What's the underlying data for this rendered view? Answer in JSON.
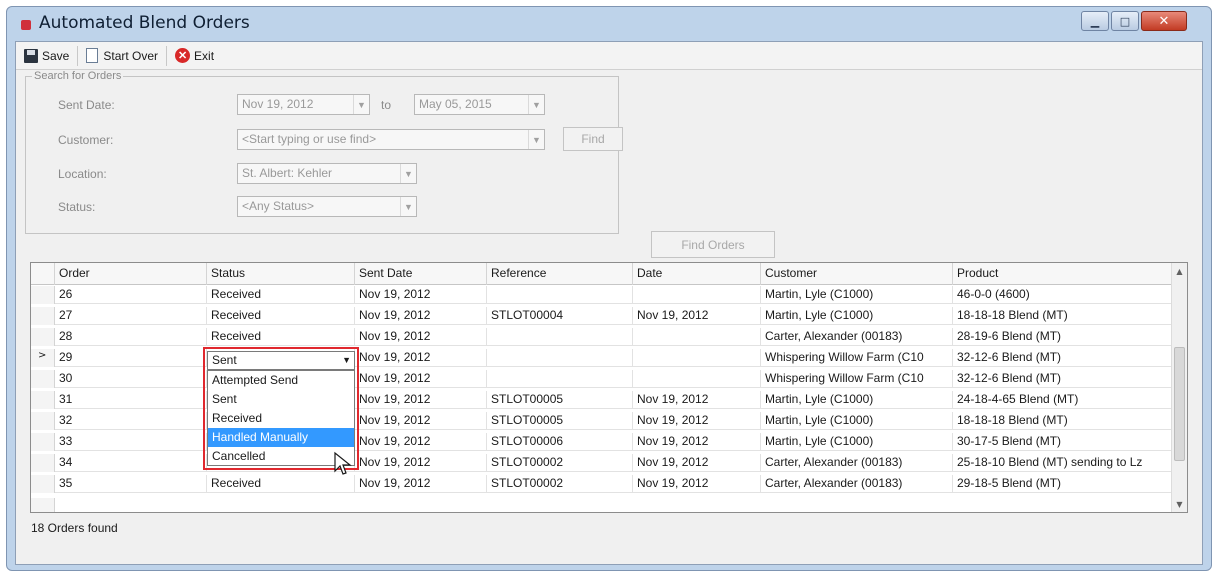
{
  "window": {
    "title": "Automated Blend Orders",
    "controls": [
      "minimize",
      "maximize",
      "close"
    ]
  },
  "toolbar": {
    "save_label": "Save",
    "start_over_label": "Start Over",
    "exit_label": "Exit"
  },
  "search": {
    "legend": "Search for Orders",
    "sent_date_label": "Sent Date:",
    "from_date": "Nov 19, 2012",
    "to_label": "to",
    "to_date": "May 05, 2015",
    "customer_label": "Customer:",
    "customer_placeholder": "<Start typing or use find>",
    "find_button": "Find",
    "location_label": "Location:",
    "location_value": "St. Albert: Kehler",
    "status_label": "Status:",
    "status_value": "<Any Status>",
    "find_orders_button": "Find Orders"
  },
  "grid": {
    "columns": [
      "Order",
      "Status",
      "Sent Date",
      "Reference",
      "Date",
      "Customer",
      "Product"
    ],
    "rows": [
      {
        "order": "26",
        "status": "Received",
        "sent_date": "Nov 19, 2012",
        "reference": "",
        "date": "",
        "customer": "Martin, Lyle (C1000)",
        "product": "46-0-0 (4600)"
      },
      {
        "order": "27",
        "status": "Received",
        "sent_date": "Nov 19, 2012",
        "reference": "STLOT00004",
        "date": "Nov 19, 2012",
        "customer": "Martin, Lyle (C1000)",
        "product": "18-18-18 Blend (MT)"
      },
      {
        "order": "28",
        "status": "Received",
        "sent_date": "Nov 19, 2012",
        "reference": "",
        "date": "",
        "customer": "Carter, Alexander (00183)",
        "product": "28-19-6 Blend (MT)"
      },
      {
        "order": "29",
        "status": "Sent",
        "sent_date": "Nov 19, 2012",
        "reference": "",
        "date": "",
        "customer": "Whispering Willow Farm (C10",
        "product": "32-12-6 Blend (MT)"
      },
      {
        "order": "30",
        "status": "",
        "sent_date": "Nov 19, 2012",
        "reference": "",
        "date": "",
        "customer": "Whispering Willow Farm (C10",
        "product": "32-12-6 Blend (MT)"
      },
      {
        "order": "31",
        "status": "",
        "sent_date": "Nov 19, 2012",
        "reference": "STLOT00005",
        "date": "Nov 19, 2012",
        "customer": "Martin, Lyle (C1000)",
        "product": "24-18-4-65 Blend (MT)"
      },
      {
        "order": "32",
        "status": "",
        "sent_date": "Nov 19, 2012",
        "reference": "STLOT00005",
        "date": "Nov 19, 2012",
        "customer": "Martin, Lyle (C1000)",
        "product": "18-18-18 Blend (MT)"
      },
      {
        "order": "33",
        "status": "",
        "sent_date": "Nov 19, 2012",
        "reference": "STLOT00006",
        "date": "Nov 19, 2012",
        "customer": "Martin, Lyle (C1000)",
        "product": "30-17-5 Blend (MT)"
      },
      {
        "order": "34",
        "status": "",
        "sent_date": "Nov 19, 2012",
        "reference": "STLOT00002",
        "date": "Nov 19, 2012",
        "customer": "Carter, Alexander (00183)",
        "product": "25-18-10 Blend (MT) sending to Lz"
      },
      {
        "order": "35",
        "status": "Received",
        "sent_date": "Nov 19, 2012",
        "reference": "STLOT00002",
        "date": "Nov 19, 2012",
        "customer": "Carter, Alexander (00183)",
        "product": "29-18-5 Blend (MT)"
      }
    ],
    "current_row_marker": ">",
    "editing_value": "Sent",
    "dropdown_options": [
      "Attempted Send",
      "Sent",
      "Received",
      "Handled Manually",
      "Cancelled"
    ],
    "highlighted_option": "Handled Manually"
  },
  "status_text": "18 Orders found",
  "colors": {
    "highlight": "#3399ff",
    "callout_border": "#e0282e",
    "window_frame": "#bed3ea"
  },
  "icons": [
    "window-app-icon",
    "save-icon",
    "document-icon",
    "exit-icon",
    "dropdown-arrow-icon",
    "mouse-cursor-icon"
  ]
}
